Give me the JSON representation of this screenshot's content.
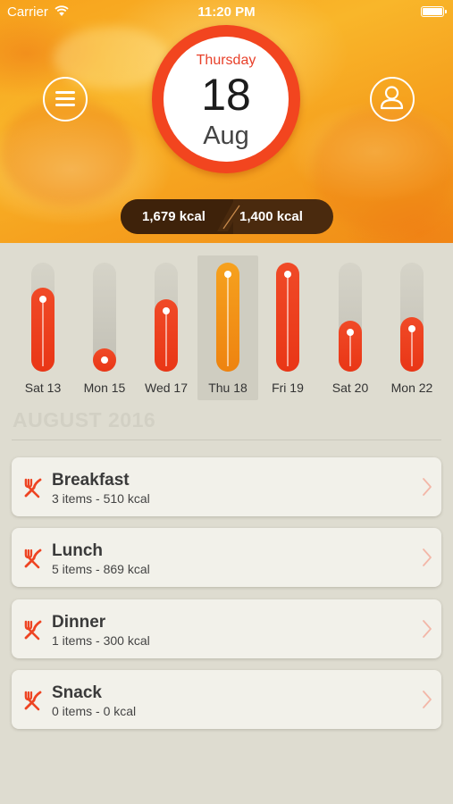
{
  "status_bar": {
    "carrier": "Carrier",
    "time": "11:20 PM"
  },
  "date": {
    "weekday": "Thursday",
    "day": "18",
    "month": "Aug"
  },
  "calories": {
    "consumed": "1,679 kcal",
    "goal": "1,400 kcal"
  },
  "week_chart": {
    "days": [
      {
        "label": "Sat 13",
        "level": 0.77,
        "selected": false
      },
      {
        "label": "Mon 15",
        "level": 0.2,
        "selected": false
      },
      {
        "label": "Wed 17",
        "level": 0.66,
        "selected": false
      },
      {
        "label": "Thu 18",
        "level": 1.0,
        "selected": true
      },
      {
        "label": "Fri 19",
        "level": 1.0,
        "selected": false
      },
      {
        "label": "Sat 20",
        "level": 0.47,
        "selected": false
      },
      {
        "label": "Mon 22",
        "level": 0.5,
        "selected": false
      }
    ]
  },
  "month_heading": "AUGUST 2016",
  "meals": [
    {
      "title": "Breakfast",
      "subtitle": "3 items - 510 kcal"
    },
    {
      "title": "Lunch",
      "subtitle": "5 items - 869 kcal"
    },
    {
      "title": "Dinner",
      "subtitle": "1 items - 300 kcal"
    },
    {
      "title": "Snack",
      "subtitle": "0 items - 0 kcal"
    }
  ],
  "colors": {
    "accent_red": "#f04a27",
    "accent_orange": "#f6a11e",
    "background": "#dedcd0",
    "card": "#f2f1ea"
  },
  "icons": {
    "menu": "menu-icon",
    "profile": "profile-icon",
    "meal": "fork-knife-icon",
    "chevron": "chevron-right-icon"
  }
}
